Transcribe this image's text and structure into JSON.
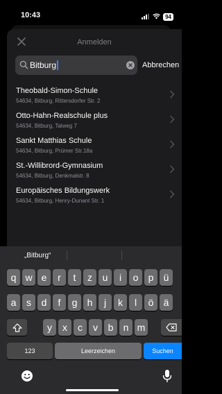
{
  "status_bar": {
    "time": "10:43",
    "battery": "94"
  },
  "sheet": {
    "title": "Anmelden"
  },
  "search": {
    "query": "Bitburg",
    "cancel_label": "Abbrechen"
  },
  "results": [
    {
      "name": "Theobald-Simon-Schule",
      "address": "54634, Bitburg, Rittersdorfer Str. 2"
    },
    {
      "name": "Otto-Hahn-Realschule plus",
      "address": "54634, Bitburg, Talweg 7"
    },
    {
      "name": "Sankt Matthias Schule",
      "address": "54634, Bitburg, Prümer Str.18a"
    },
    {
      "name": "St.-Willibrord-Gymnasium",
      "address": "54634, Bitburg, Denkmalstr. 8"
    },
    {
      "name": "Europäisches Bildungswerk",
      "address": "54634, Bitburg, Henry-Dunant Str. 1"
    }
  ],
  "keyboard": {
    "suggestion": "„Bitburg“",
    "row1": [
      "q",
      "w",
      "e",
      "r",
      "t",
      "z",
      "u",
      "i",
      "o",
      "p",
      "ü"
    ],
    "row2": [
      "a",
      "s",
      "d",
      "f",
      "g",
      "h",
      "j",
      "k",
      "l",
      "ö",
      "ä"
    ],
    "row3": [
      "y",
      "x",
      "c",
      "v",
      "b",
      "n",
      "m"
    ],
    "numbers_label": "123",
    "space_label": "Leerzeichen",
    "return_label": "Suchen"
  },
  "colors": {
    "accent": "#0a84ff",
    "caret": "#3b82f6",
    "sheet_bg": "#1c1c1e",
    "key_bg": "#6c6c6e"
  }
}
